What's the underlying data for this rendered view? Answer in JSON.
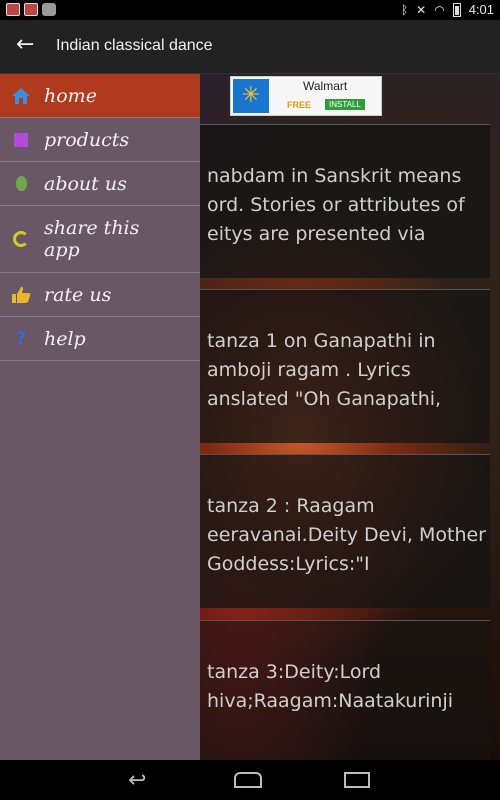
{
  "status_bar": {
    "time": "4:01"
  },
  "action_bar": {
    "title": "Indian classical dance",
    "back_icon": "arrow-left-icon"
  },
  "ad": {
    "brand": "Walmart",
    "free": "FREE",
    "install": "INSTALL"
  },
  "content": {
    "cards": [
      {
        "text": "nabdam in Sanskrit means ord. Stories or attributes of eitys are presented via"
      },
      {
        "text": "tanza 1 on Ganapathi in amboji ragam . Lyrics anslated \"Oh Ganapathi,"
      },
      {
        "text": "tanza 2 : Raagam eeravanai.Deity Devi, Mother Goddess:Lyrics:\"I"
      },
      {
        "text": "tanza 3:Deity:Lord hiva;Raagam:Naatakurinji"
      }
    ]
  },
  "drawer": {
    "items": [
      {
        "label": "home",
        "icon": "home-icon",
        "selected": true
      },
      {
        "label": "products",
        "icon": "square-icon"
      },
      {
        "label": "about us",
        "icon": "pear-icon"
      },
      {
        "label": "share this app",
        "icon": "share-icon"
      },
      {
        "label": "rate us",
        "icon": "thumbs-up-icon"
      },
      {
        "label": "help",
        "icon": "help-icon",
        "glyph": "?"
      }
    ]
  },
  "colors": {
    "drawer_bg": "#6a5765",
    "selected_bg": "#b03a1e",
    "action_bar_bg": "#222222"
  }
}
